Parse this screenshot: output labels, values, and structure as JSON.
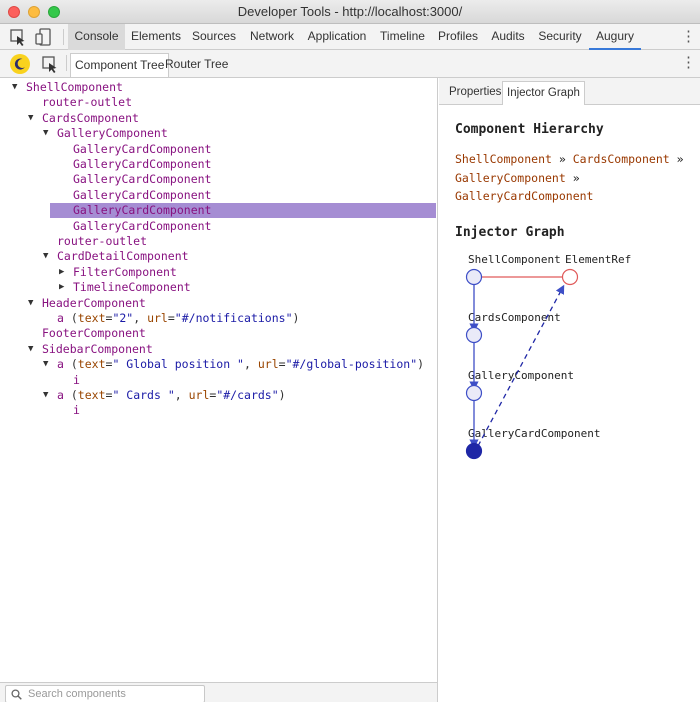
{
  "window": {
    "title": "Developer Tools - http://localhost:3000/"
  },
  "main_tabs": [
    {
      "label": "Console"
    },
    {
      "label": "Elements"
    },
    {
      "label": "Sources"
    },
    {
      "label": "Network"
    },
    {
      "label": "Application"
    },
    {
      "label": "Timeline"
    },
    {
      "label": "Profiles"
    },
    {
      "label": "Audits"
    },
    {
      "label": "Security"
    },
    {
      "label": "Augury"
    }
  ],
  "sub_tabs": {
    "component_tree": "Component Tree",
    "router_tree": "Router Tree"
  },
  "tree": [
    {
      "arrow": "▼",
      "parts": [
        {
          "t": "ShellComponent",
          "c": "tag"
        }
      ]
    },
    {
      "arrow": "",
      "parts": [
        {
          "t": "router-outlet",
          "c": "tag"
        }
      ]
    },
    {
      "arrow": "▼",
      "parts": [
        {
          "t": "CardsComponent",
          "c": "tag"
        }
      ]
    },
    {
      "arrow": "▼",
      "parts": [
        {
          "t": "GalleryComponent",
          "c": "tag"
        }
      ]
    },
    {
      "arrow": "",
      "parts": [
        {
          "t": "GalleryCardComponent",
          "c": "tag"
        }
      ]
    },
    {
      "arrow": "",
      "parts": [
        {
          "t": "GalleryCardComponent",
          "c": "tag"
        }
      ]
    },
    {
      "arrow": "",
      "parts": [
        {
          "t": "GalleryCardComponent",
          "c": "tag"
        }
      ]
    },
    {
      "arrow": "",
      "parts": [
        {
          "t": "GalleryCardComponent",
          "c": "tag"
        }
      ]
    },
    {
      "arrow": "",
      "parts": [
        {
          "t": "GalleryCardComponent",
          "c": "tag"
        }
      ],
      "selected": true
    },
    {
      "arrow": "",
      "parts": [
        {
          "t": "GalleryCardComponent",
          "c": "tag"
        }
      ]
    },
    {
      "arrow": "",
      "parts": [
        {
          "t": "router-outlet",
          "c": "tag"
        }
      ]
    },
    {
      "arrow": "▼",
      "parts": [
        {
          "t": "CardDetailComponent",
          "c": "tag"
        }
      ]
    },
    {
      "arrow": "▶",
      "parts": [
        {
          "t": "FilterComponent",
          "c": "tag"
        }
      ]
    },
    {
      "arrow": "▶",
      "parts": [
        {
          "t": "TimelineComponent",
          "c": "tag"
        }
      ]
    },
    {
      "arrow": "▼",
      "parts": [
        {
          "t": "HeaderComponent",
          "c": "tag"
        }
      ]
    },
    {
      "arrow": "",
      "parts": [
        {
          "t": "a",
          "c": "tag"
        },
        {
          "t": " (",
          "c": "plain"
        },
        {
          "t": "text",
          "c": "attr-name"
        },
        {
          "t": "=",
          "c": "plain"
        },
        {
          "t": "\"2\"",
          "c": "attr-val"
        },
        {
          "t": ", ",
          "c": "plain"
        },
        {
          "t": "url",
          "c": "attr-name"
        },
        {
          "t": "=",
          "c": "plain"
        },
        {
          "t": "\"#/notifications\"",
          "c": "attr-val"
        },
        {
          "t": ")",
          "c": "plain"
        }
      ]
    },
    {
      "arrow": "",
      "parts": [
        {
          "t": "FooterComponent",
          "c": "tag"
        }
      ]
    },
    {
      "arrow": "▼",
      "parts": [
        {
          "t": "SidebarComponent",
          "c": "tag"
        }
      ]
    },
    {
      "arrow": "▼",
      "parts": [
        {
          "t": "a",
          "c": "tag"
        },
        {
          "t": " (",
          "c": "plain"
        },
        {
          "t": "text",
          "c": "attr-name"
        },
        {
          "t": "=",
          "c": "plain"
        },
        {
          "t": "\" Global position \"",
          "c": "attr-val"
        },
        {
          "t": ", ",
          "c": "plain"
        },
        {
          "t": "url",
          "c": "attr-name"
        },
        {
          "t": "=",
          "c": "plain"
        },
        {
          "t": "\"#/global-position\"",
          "c": "attr-val"
        },
        {
          "t": ")",
          "c": "plain"
        }
      ]
    },
    {
      "arrow": "",
      "parts": [
        {
          "t": "i",
          "c": "tag"
        }
      ]
    },
    {
      "arrow": "▼",
      "parts": [
        {
          "t": "a",
          "c": "tag"
        },
        {
          "t": " (",
          "c": "plain"
        },
        {
          "t": "text",
          "c": "attr-name"
        },
        {
          "t": "=",
          "c": "plain"
        },
        {
          "t": "\" Cards \"",
          "c": "attr-val"
        },
        {
          "t": ", ",
          "c": "plain"
        },
        {
          "t": "url",
          "c": "attr-name"
        },
        {
          "t": "=",
          "c": "plain"
        },
        {
          "t": "\"#/cards\"",
          "c": "attr-val"
        },
        {
          "t": ")",
          "c": "plain"
        }
      ]
    },
    {
      "arrow": "",
      "parts": [
        {
          "t": "i",
          "c": "tag"
        }
      ]
    }
  ],
  "search": {
    "placeholder": "Search components",
    "value": ""
  },
  "right_tabs": {
    "properties": "Properties",
    "injector_graph": "Injector Graph"
  },
  "hierarchy": {
    "heading": "Component Hierarchy",
    "crumbs": [
      "ShellComponent",
      "CardsComponent",
      "GalleryComponent",
      "GalleryCardComponent"
    ],
    "separator": "»"
  },
  "injector": {
    "heading": "Injector Graph",
    "nodes": [
      {
        "label": "ShellComponent"
      },
      {
        "label": "CardsComponent"
      },
      {
        "label": "GalleryComponent"
      },
      {
        "label": "GalleryCardComponent"
      }
    ],
    "dependency": {
      "label": "ElementRef"
    }
  },
  "colors": {
    "selection": "#a58dd3",
    "tag": "#881280",
    "attr_name": "#994500",
    "attr_value": "#1a1aa6",
    "crumb": "#993800",
    "node_stroke": "#3e4fc7",
    "node_fill": "#eaeaf8",
    "selected_node": "#1f27a6",
    "dependency_node": "#e05a5a",
    "accent": "#3879d9"
  }
}
